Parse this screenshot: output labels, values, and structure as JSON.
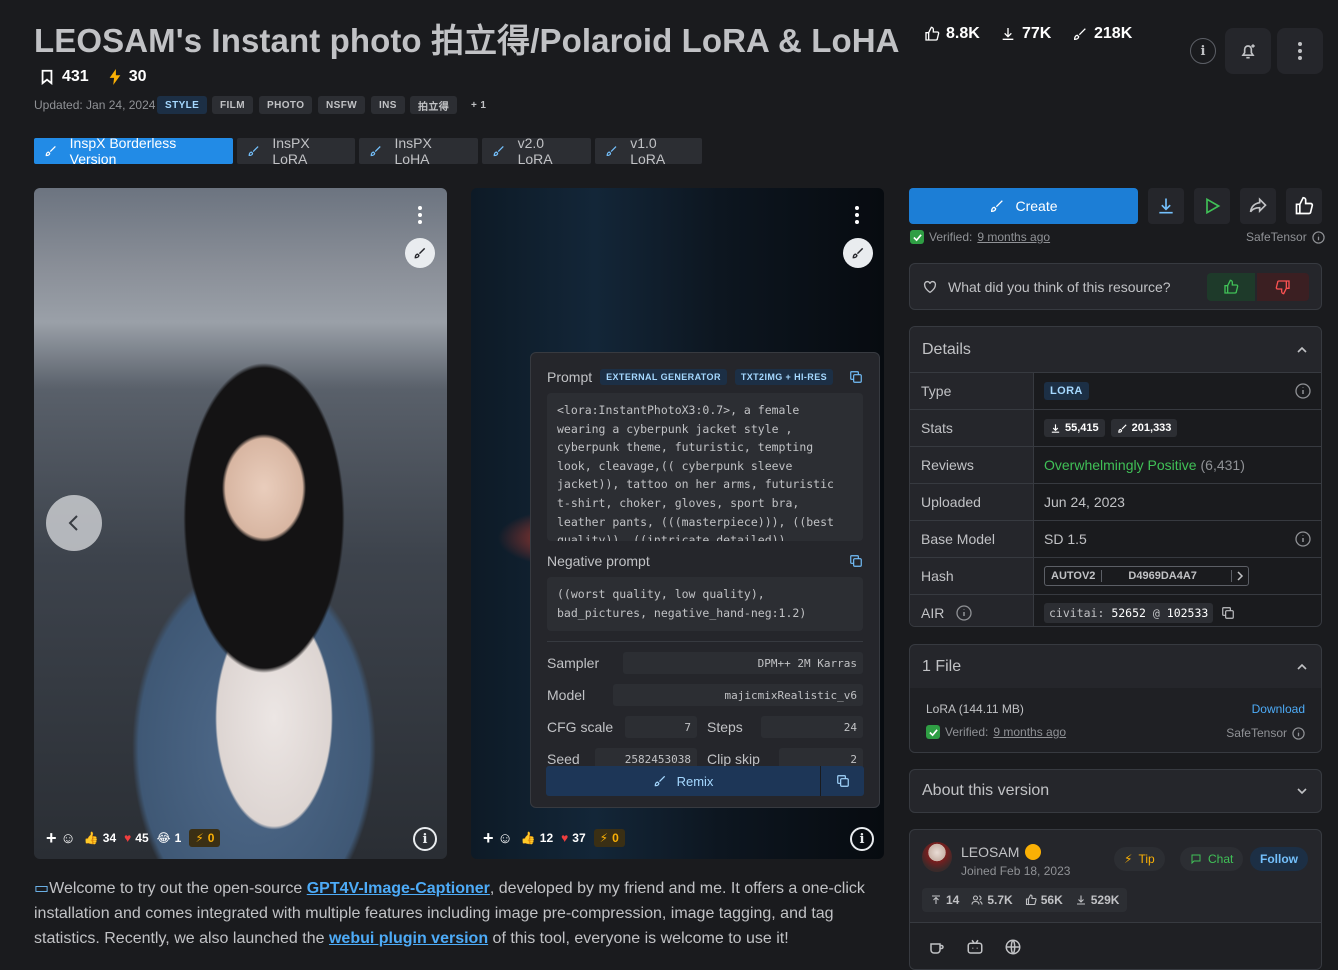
{
  "header": {
    "title": "LEOSAM's Instant photo 拍立得/Polaroid LoRA & LoHA",
    "likes": "8.8K",
    "downloads": "77K",
    "generations": "218K",
    "bookmarks": "431",
    "buzz": "30",
    "updated": "Updated: Jan 24, 2024",
    "tags": [
      "STYLE",
      "FILM",
      "PHOTO",
      "NSFW",
      "INS",
      "拍立得",
      "+ 1"
    ]
  },
  "versions": [
    "InspX Borderless Version",
    "InsPX LoRA",
    "InsPX LoHA",
    "v2.0 LoRA",
    "v1.0 LoRA"
  ],
  "gallery": {
    "image1": {
      "likes": "34",
      "hearts": "45",
      "laugh": "1",
      "buzz": "0"
    },
    "image2": {
      "likes": "12",
      "hearts": "37",
      "buzz": "0"
    }
  },
  "generation": {
    "prompt_label": "Prompt",
    "badge1": "EXTERNAL GENERATOR",
    "badge2": "TXT2IMG + HI-RES",
    "prompt": "<lora:InstantPhotoX3:0.7>, a female wearing a cyberpunk jacket style , cyberpunk theme, futuristic, tempting look, cleavage,(( cyberpunk sleeve jacket)), tattoo on her arms, futuristic t-shirt, choker, gloves, sport bra, leather pants, (((masterpiece))), ((best quality)), ((intricate detailed))",
    "negative_label": "Negative prompt",
    "negative": "((worst quality, low quality), bad_pictures, negative_hand-neg:1.2)",
    "sampler_label": "Sampler",
    "sampler": "DPM++ 2M Karras",
    "model_label": "Model",
    "model": "majicmixRealistic_v6",
    "cfg_label": "CFG scale",
    "cfg": "7",
    "steps_label": "Steps",
    "steps": "24",
    "seed_label": "Seed",
    "seed": "2582453038",
    "clip_label": "Clip skip",
    "clip": "2",
    "remix": "Remix"
  },
  "description": {
    "p1": "Welcome to try out the open-source ",
    "link1": "GPT4V-Image-Captioner",
    "p2": ", developed by my friend and me. It offers a one-click installation and comes integrated with multiple features including image pre-compression, image tagging, and tag statistics. Recently, we also launched the ",
    "link2": "webui plugin version",
    "p3": " of this tool, everyone is welcome to use it!"
  },
  "actions": {
    "create": "Create",
    "verified_label": "Verified:",
    "verified_when": "9 months ago",
    "safetensor": "SafeTensor",
    "feedback_q": "What did you think of this resource?"
  },
  "details": {
    "title": "Details",
    "type_label": "Type",
    "type": "LORA",
    "stats_label": "Stats",
    "stat_downloads": "55,415",
    "stat_generations": "201,333",
    "reviews_label": "Reviews",
    "reviews": "Overwhelmingly Positive",
    "reviews_count": "(6,431)",
    "uploaded_label": "Uploaded",
    "uploaded": "Jun 24, 2023",
    "base_label": "Base Model",
    "base": "SD 1.5",
    "hash_label": "Hash",
    "hash_type": "AUTOV2",
    "hash": "D4969DA4A7",
    "air_label": "AIR",
    "air_prefix": "civitai:",
    "air_model": "52652",
    "air_at": "@",
    "air_version": "102533"
  },
  "files": {
    "title": "1 File",
    "name": "LoRA (144.11 MB)",
    "download": "Download",
    "verified_label": "Verified:",
    "verified_when": "9 months ago",
    "safetensor": "SafeTensor"
  },
  "about": {
    "title": "About this version"
  },
  "creator": {
    "name": "LEOSAM",
    "joined": "Joined Feb 18, 2023",
    "tip": "Tip",
    "chat": "Chat",
    "follow": "Follow",
    "uploads": "14",
    "followers": "5.7K",
    "likes": "56K",
    "downloads": "529K"
  },
  "colors": {
    "accent": "#228be6",
    "positive": "#40c057",
    "buzz": "#fab005"
  }
}
